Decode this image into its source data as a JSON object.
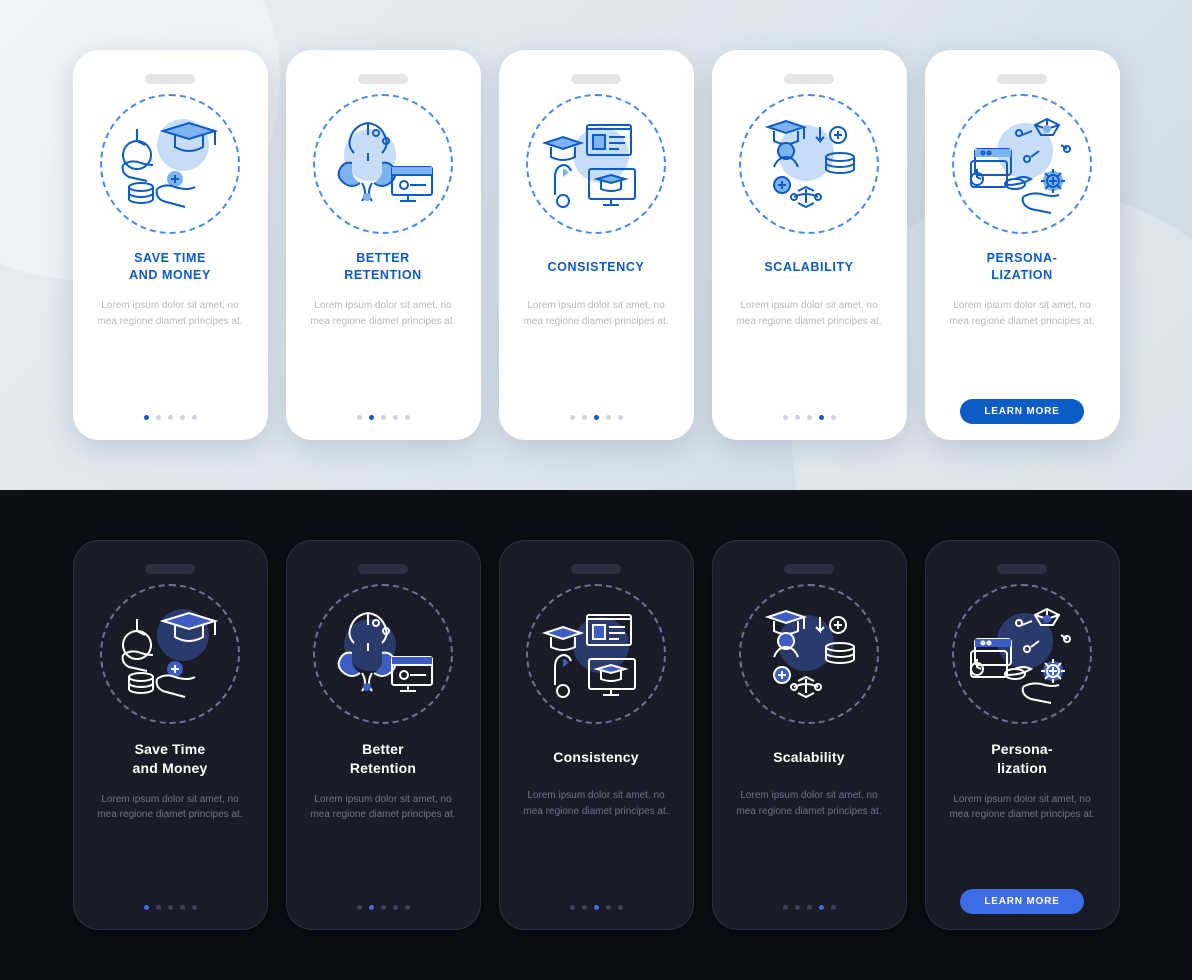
{
  "light": {
    "screens": [
      {
        "title": "SAVE TIME\nAND MONEY",
        "desc": "Lorem ipsum dolor sit amet, no mea regione diamet principes at.",
        "active": 0,
        "icon": "save-time-money"
      },
      {
        "title": "BETTER\nRETENTION",
        "desc": "Lorem ipsum dolor sit amet, no mea regione diamet principes at.",
        "active": 1,
        "icon": "retention"
      },
      {
        "title": "CONSISTENCY",
        "desc": "Lorem ipsum dolor sit amet, no mea regione diamet principes at.",
        "active": 2,
        "icon": "consistency"
      },
      {
        "title": "SCALABILITY",
        "desc": "Lorem ipsum dolor sit amet, no mea regione diamet principes at.",
        "active": 3,
        "icon": "scalability"
      },
      {
        "title": "PERSONA-\nLIZATION",
        "desc": "Lorem ipsum dolor sit amet, no mea regione diamet principes at.",
        "active": 4,
        "icon": "personalization",
        "cta": "LEARN MORE"
      }
    ]
  },
  "dark": {
    "screens": [
      {
        "title": "Save Time\nand Money",
        "desc": "Lorem ipsum dolor sit amet, no mea regione diamet principes at.",
        "active": 0,
        "icon": "save-time-money"
      },
      {
        "title": "Better\nRetention",
        "desc": "Lorem ipsum dolor sit amet, no mea regione diamet principes at.",
        "active": 1,
        "icon": "retention"
      },
      {
        "title": "Consistency",
        "desc": "Lorem ipsum dolor sit amet, no mea regione diamet principes at.",
        "active": 2,
        "icon": "consistency"
      },
      {
        "title": "Scalability",
        "desc": "Lorem ipsum dolor sit amet, no mea regione diamet principes at.",
        "active": 3,
        "icon": "scalability"
      },
      {
        "title": "Persona-\nlization",
        "desc": "Lorem ipsum dolor sit amet, no mea regione diamet principes at.",
        "active": 4,
        "icon": "personalization",
        "cta": "LEARN MORE"
      }
    ]
  },
  "dot_count": 5
}
